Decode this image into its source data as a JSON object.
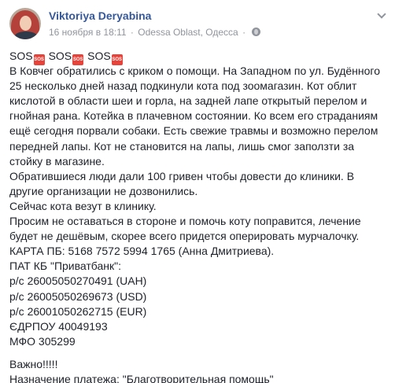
{
  "post": {
    "author": "Viktoriya Deryabina",
    "time": "16 ноября в 18:11",
    "location": "Odessa Oblast, Одесса",
    "sos_text": "SOS",
    "sos_badge_text": "SOS",
    "paragraph1": [
      "В Ковчег обратились с криком о помощи. На Западном по ул. Будённого",
      "25 несколько дней назад подкинули кота под зоомагазин. Кот облит",
      "кислотой в области шеи и горла, на задней лапе открытый перелом и",
      "гнойная рана. Котейка в плачевном состоянии. Ко всем его страданиям",
      "ещё сегодня порвали собаки. Есть свежие травмы и возможно перелом",
      "передней лапы. Кот не становится на лапы, лишь смог заползти за",
      "стойку в магазине."
    ],
    "paragraph2": [
      "Обратившиеся люди дали 100 гривен чтобы довести до клиники. В",
      "другие организации не дозвонились.",
      "Сейчас кота везут в клинику."
    ],
    "paragraph3": [
      "Просим не оставаться в стороне и помочь коту поправится, лечение",
      "будет не дешёвым, скорее всего придется оперировать мурчалочку.",
      "КАРТА ПБ: 5168 7572 5994 1765 (Анна Дмитриева).",
      "ПАТ КБ \"Приватбанк\":",
      "р/с 26005050270491 (UAH)",
      "р/с 26005050269673 (USD)",
      "р/с 26001050262715 (EUR)",
      "ЄДРПОУ 40049193",
      "МФО 305299"
    ],
    "paragraph4": [
      "Важно!!!!!",
      "Назначение платежа: \"Благотворительная помощь\""
    ]
  },
  "colors": {
    "link": "#365899",
    "meta": "#90949c",
    "text": "#1d2129",
    "sos": "#e8433a"
  },
  "icons": {
    "privacy": "globe-icon",
    "menu": "chevron-down-icon"
  }
}
